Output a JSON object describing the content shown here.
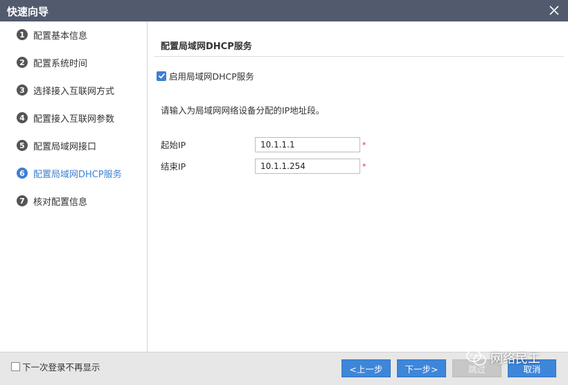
{
  "window": {
    "title": "快速向导"
  },
  "steps": [
    {
      "num": "1",
      "label": "配置基本信息"
    },
    {
      "num": "2",
      "label": "配置系统时间"
    },
    {
      "num": "3",
      "label": "选择接入互联网方式"
    },
    {
      "num": "4",
      "label": "配置接入互联网参数"
    },
    {
      "num": "5",
      "label": "配置局域网接口"
    },
    {
      "num": "6",
      "label": "配置局域网DHCP服务",
      "active": true
    },
    {
      "num": "7",
      "label": "核对配置信息"
    }
  ],
  "main": {
    "section_title": "配置局域网DHCP服务",
    "enable_checkbox": {
      "label": "启用局域网DHCP服务",
      "checked": true
    },
    "instruction": "请输入为局域网网络设备分配的IP地址段。",
    "fields": [
      {
        "label": "起始IP",
        "value": "10.1.1.1",
        "required_mark": "*"
      },
      {
        "label": "结束IP",
        "value": "10.1.1.254",
        "required_mark": "*"
      }
    ]
  },
  "footer": {
    "dont_show_label": "下一次登录不再显示",
    "prev_label": "<上一步",
    "next_label": "下一步>",
    "skip_label": "跳过",
    "cancel_label": "取消"
  },
  "watermark": {
    "text": "网络民工"
  },
  "colors": {
    "titlebar": "#525a6e",
    "accent": "#3d86d9",
    "active_step": "#3d7fd4",
    "required": "#e03030",
    "footer_bg": "#e7e7e7"
  },
  "icons": {
    "close": "close-icon",
    "check": "check-icon",
    "watermark": "wechat-icon"
  }
}
